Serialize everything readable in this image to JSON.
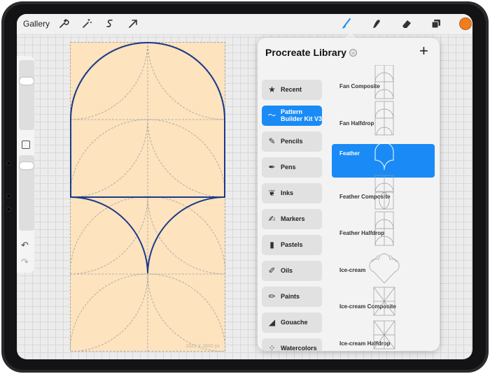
{
  "topbar": {
    "gallery_label": "Gallery",
    "tools": [
      "wrench-icon",
      "magic-wand-icon",
      "selection-icon",
      "transform-arrow-icon",
      "brush-icon",
      "smudge-icon",
      "eraser-icon",
      "layers-icon"
    ],
    "accent_color": "#1a8bf6",
    "current_color": "#f07d1f"
  },
  "canvas": {
    "size_label": "1820 X 3600 px",
    "fill_color": "#fde3be",
    "stroke_color": "#1c3a8a"
  },
  "library": {
    "title": "Procreate Library",
    "add_label": "+",
    "categories": [
      {
        "label": "Recent",
        "icon": "star-icon"
      },
      {
        "label": "Pattern Builder Kit V3",
        "icon": "brush-stroke-icon"
      },
      {
        "label": "Pencils",
        "icon": "pencil-icon"
      },
      {
        "label": "Pens",
        "icon": "pen-icon"
      },
      {
        "label": "Inks",
        "icon": "ink-icon"
      },
      {
        "label": "Markers",
        "icon": "marker-icon"
      },
      {
        "label": "Pastels",
        "icon": "pastel-icon"
      },
      {
        "label": "Oils",
        "icon": "oil-brush-icon"
      },
      {
        "label": "Paints",
        "icon": "paint-brush-icon"
      },
      {
        "label": "Gouache",
        "icon": "gouache-tube-icon"
      },
      {
        "label": "Watercolors",
        "icon": "watercolor-icon"
      }
    ],
    "active_category": 1,
    "brushes": [
      {
        "label": "Fan Composite"
      },
      {
        "label": "Fan Halfdrop"
      },
      {
        "label": "Feather"
      },
      {
        "label": "Feather Composite"
      },
      {
        "label": "Feather Halfdrop"
      },
      {
        "label": "Ice-cream"
      },
      {
        "label": "Ice-cream Composite"
      },
      {
        "label": "Ice-cream Halfdrop"
      }
    ],
    "active_brush": 2
  }
}
